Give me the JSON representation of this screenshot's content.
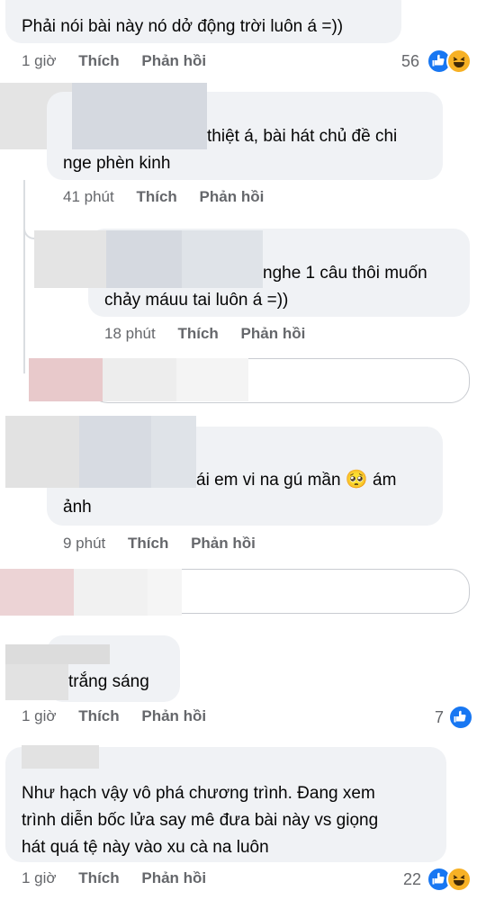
{
  "comments": [
    {
      "text_lines": [
        "Phải nói bài này nó dở động trời luôn á =))"
      ],
      "time": "1 giờ",
      "like_label": "Thích",
      "reply_label": "Phản hồi",
      "reaction_count": "56",
      "reactions": [
        "like-icon",
        "haha-icon"
      ]
    },
    {
      "text_lines": [
        "thiệt á, bài hát chủ đề chi",
        "nge phèn kinh"
      ],
      "time": "41 phút",
      "like_label": "Thích",
      "reply_label": "Phản hồi"
    },
    {
      "text_lines": [
        "nghe 1 câu thôi muốn",
        "chảy máuu tai luôn á =))"
      ],
      "time": "18 phút",
      "like_label": "Thích",
      "reply_label": "Phản hồi"
    },
    {
      "text_lines": [
        "ái em vi na gú mần",
        "ám",
        "ảnh"
      ],
      "emoji": "🥺",
      "time": "9 phút",
      "like_label": "Thích",
      "reply_label": "Phản hồi"
    },
    {
      "text_lines": [
        "trắng sáng"
      ],
      "time": "1 giờ",
      "like_label": "Thích",
      "reply_label": "Phản hồi",
      "reaction_count": "7",
      "reactions": [
        "like-icon"
      ]
    },
    {
      "text_lines": [
        "Như hạch vậy vô phá chương trình. Đang xem",
        "trình diễn bốc lửa say mê đưa bài này vs giọng",
        "hát quá tệ này vào xu cà na luôn"
      ],
      "time": "1 giờ",
      "like_label": "Thích",
      "reply_label": "Phản hồi",
      "reaction_count": "22",
      "reactions": [
        "like-icon",
        "haha-icon"
      ]
    }
  ],
  "colors": {
    "bubble": "#f0f2f5",
    "meta_text": "#65676b",
    "like_blue": "#1877f2",
    "haha_yellow": "#f7b125"
  }
}
